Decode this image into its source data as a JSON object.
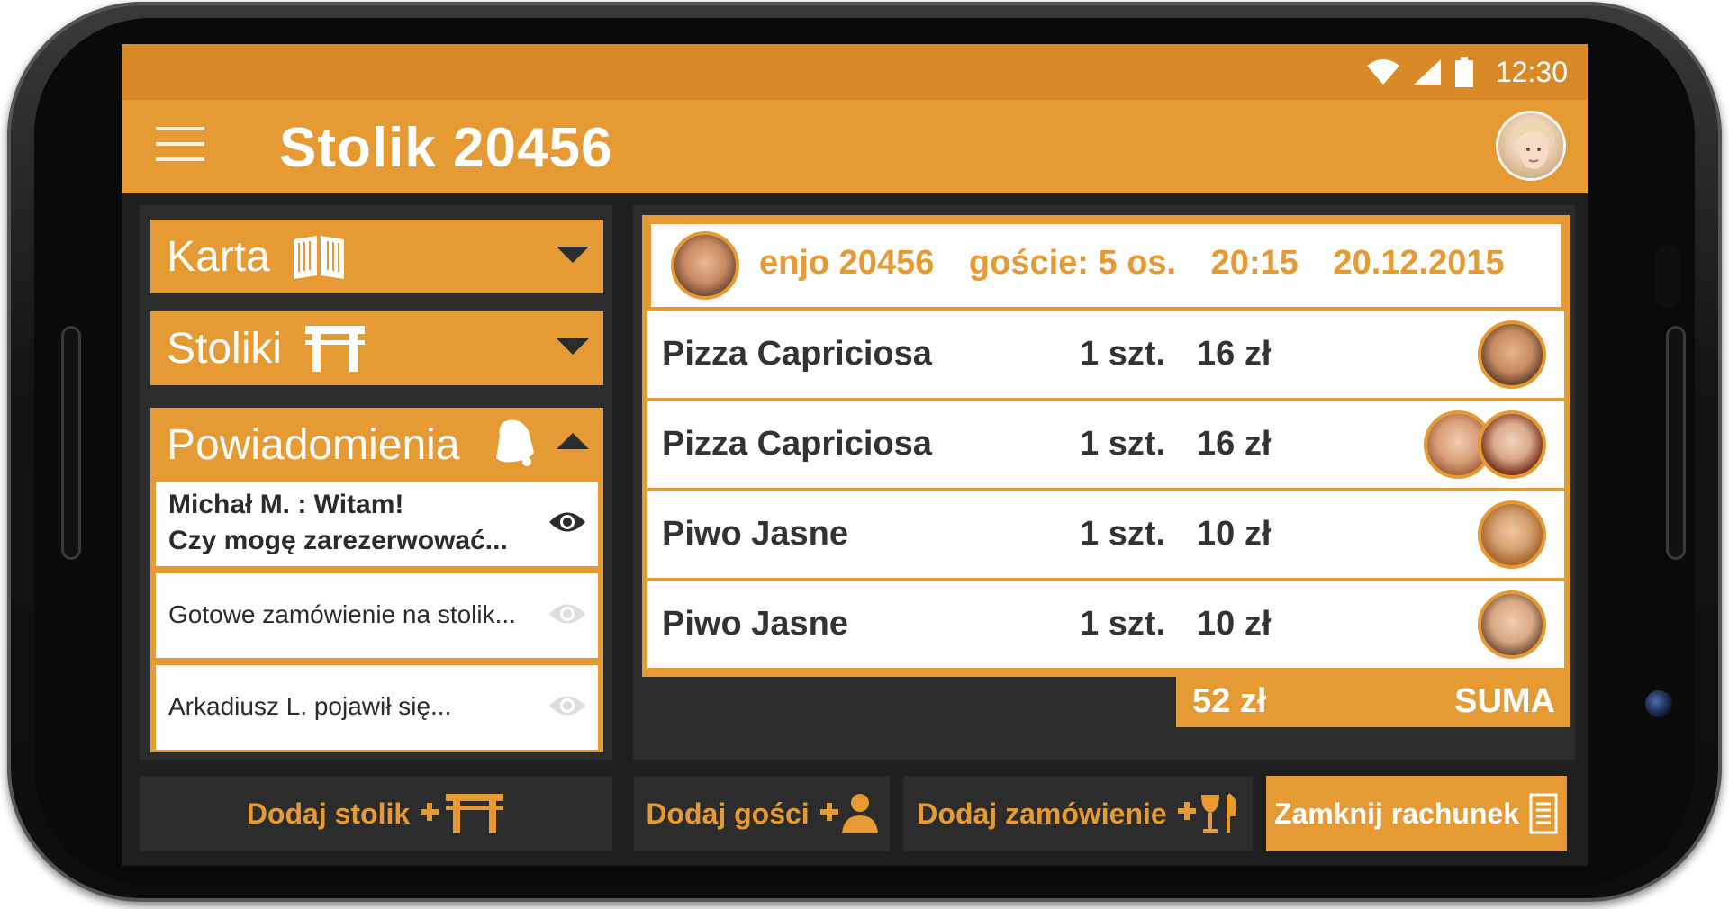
{
  "status": {
    "time": "12:30"
  },
  "app": {
    "title": "Stolik 20456"
  },
  "left": {
    "karta": "Karta",
    "stoliki": "Stoliki",
    "powiadomienia": "Powiadomienia",
    "notifications": [
      {
        "line1": "Michał M. : Witam!",
        "line2": "Czy mogę zarezerwować..."
      },
      {
        "text": "Gotowe zamówienie na stolik..."
      },
      {
        "text": "Arkadiusz L. pojawił się..."
      }
    ]
  },
  "order": {
    "header": {
      "name": "enjo 20456",
      "guests": "goście: 5 os.",
      "time": "20:15",
      "date": "20.12.2015"
    },
    "items": [
      {
        "name": "Pizza Capriciosa",
        "qty": "1 szt.",
        "price": "16 zł"
      },
      {
        "name": "Pizza Capriciosa",
        "qty": "1 szt.",
        "price": "16 zł"
      },
      {
        "name": "Piwo Jasne",
        "qty": "1 szt.",
        "price": "10 zł"
      },
      {
        "name": "Piwo Jasne",
        "qty": "1 szt.",
        "price": "10 zł"
      }
    ],
    "sum_value": "52 zł",
    "sum_label": "SUMA"
  },
  "buttons": {
    "add_table": "Dodaj stolik",
    "add_guests": "Dodaj gości",
    "add_order": "Dodaj zamówienie",
    "close_bill": "Zamknij rachunek"
  },
  "colors": {
    "accent": "#e69a33",
    "statusbar": "#d98a26",
    "panel": "#2c2c2c",
    "background": "#1f1f1f"
  }
}
